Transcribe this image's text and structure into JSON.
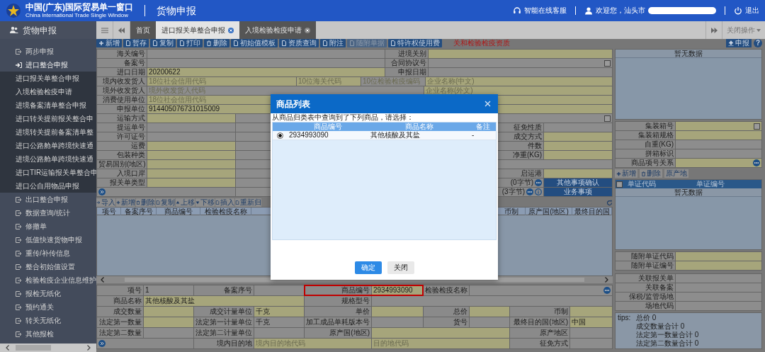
{
  "header": {
    "title": "中国(广东)国际贸易单一窗口",
    "subtitle": "China International Trade Single Window",
    "module": "货物申报",
    "service": "智能在线客服",
    "welcome": "欢迎您，汕头市",
    "logout": "退出"
  },
  "tab_bar": {
    "menu_title": "货物申报",
    "close_menu": "关闭操作",
    "tabs": [
      {
        "label": "首页",
        "selected": false,
        "closable": false
      },
      {
        "label": "进口报关单整合申报",
        "selected": true,
        "closable": true
      },
      {
        "label": "入境检验检疫申请",
        "selected": false,
        "closable": true
      }
    ]
  },
  "sidebar": {
    "items": [
      {
        "label": "两步申报",
        "expanded": false
      },
      {
        "label": "进口整合申报",
        "expanded": true,
        "children": [
          {
            "label": "进口报关单整合申报"
          },
          {
            "label": "入境检验检疫申请"
          },
          {
            "label": "进境备案清单整合申报"
          },
          {
            "label": "进口转关提前报关整合申"
          },
          {
            "label": "进境转关提前备案清单整"
          },
          {
            "label": "进口公路舱单跨境快速通"
          },
          {
            "label": "进境公路舱单跨境快速通"
          },
          {
            "label": "进口TIR运输报关单整合申"
          },
          {
            "label": "进口公自用物品申报"
          }
        ]
      },
      {
        "label": "出口整合申报",
        "expanded": false
      },
      {
        "label": "数据查询/统计",
        "expanded": false
      },
      {
        "label": "修撤单",
        "expanded": false
      },
      {
        "label": "低值快速货物申报",
        "expanded": false
      },
      {
        "label": "重传/补传信息",
        "expanded": false
      },
      {
        "label": "整合初始值设置",
        "expanded": false
      },
      {
        "label": "检验检疫企业信息维护",
        "expanded": false
      },
      {
        "label": "报检无纸化",
        "expanded": false
      },
      {
        "label": "预约通关",
        "expanded": false
      },
      {
        "label": "转关无纸化",
        "expanded": false
      },
      {
        "label": "其他报检",
        "expanded": false
      }
    ]
  },
  "toolbar": {
    "notice": "关和检验检疫资质",
    "buttons": [
      {
        "label": "新增",
        "disabled": false
      },
      {
        "label": "暂存",
        "disabled": false
      },
      {
        "label": "复制",
        "disabled": false
      },
      {
        "label": "打印",
        "disabled": false
      },
      {
        "label": "删除",
        "disabled": false
      },
      {
        "label": "初始值模板",
        "disabled": false
      },
      {
        "label": "资质查询",
        "disabled": false
      },
      {
        "label": "附注",
        "disabled": false
      },
      {
        "label": "随附单据",
        "disabled": true
      },
      {
        "label": "特许权使用费",
        "disabled": false
      }
    ]
  },
  "declaration_form": {
    "rows": [
      {
        "groups": [
          {
            "label": "海关编号",
            "inputs": [
              {
                "kind": "field",
                "required": false
              }
            ]
          },
          {
            "label": "进境关别",
            "inputs": [
              {
                "kind": "field",
                "required": true
              }
            ]
          }
        ]
      },
      {
        "groups": [
          {
            "label": "备案号",
            "inputs": [
              {
                "kind": "field",
                "required": false
              }
            ]
          },
          {
            "label": "合同协议号",
            "inputs": [
              {
                "kind": "field",
                "required": false,
                "checked": false
              }
            ]
          }
        ]
      },
      {
        "groups": [
          {
            "label": "进口日期",
            "inputs": [
              {
                "kind": "field",
                "required": true,
                "value": "20200622"
              }
            ]
          },
          {
            "label": "申报日期",
            "inputs": [
              {
                "kind": "field",
                "required": false
              }
            ]
          }
        ]
      },
      {
        "groups": [
          {
            "label": "境内收发货人",
            "inputs": [
              {
                "kind": "field",
                "required": true,
                "placeholder": "18位社会信用代码"
              },
              {
                "kind": "field",
                "required": true,
                "placeholder": "10位海关代码"
              },
              {
                "kind": "field",
                "required": false,
                "placeholder": "10位检验检疫编码"
              },
              {
                "kind": "field",
                "required": true,
                "placeholder": "企业名称(中文)"
              }
            ]
          }
        ]
      },
      {
        "groups": [
          {
            "label": "境外收发货人",
            "inputs": [
              {
                "kind": "field",
                "required": false,
                "placeholder": "境外收发货人代码"
              },
              {
                "kind": "field",
                "required": true,
                "placeholder": "企业名称(外文)"
              }
            ]
          }
        ]
      },
      {
        "groups": [
          {
            "label": "消费使用单位",
            "inputs": [
              {
                "kind": "field",
                "required": true,
                "placeholder": "18位社会信用代码"
              },
              {
                "kind": "field",
                "required": true
              }
            ]
          }
        ]
      },
      {
        "groups": [
          {
            "label": "申报单位",
            "inputs": [
              {
                "kind": "field",
                "required": true,
                "value": "914405076731015009"
              },
              {
                "kind": "field",
                "required": true
              }
            ]
          }
        ]
      },
      {
        "groups": [
          {
            "label": "运输方式",
            "inputs": [
              {
                "kind": "field",
                "required": true
              },
              {
                "kind": "field",
                "required": false,
                "checked": false
              }
            ]
          }
        ]
      },
      {
        "groups": [
          {
            "label": "提运单号",
            "inputs": [
              {
                "kind": "field",
                "required": false
              },
              {
                "kind": "field",
                "required": false
              }
            ]
          },
          {
            "label": "征免性质",
            "inputs": [
              {
                "kind": "field",
                "required": false
              }
            ]
          }
        ]
      },
      {
        "groups": [
          {
            "label": "许可证号",
            "inputs": [
              {
                "kind": "field",
                "required": false
              },
              {
                "kind": "field",
                "required": false
              }
            ]
          },
          {
            "label": "成交方式",
            "inputs": [
              {
                "kind": "field",
                "required": true
              }
            ]
          }
        ]
      },
      {
        "groups": [
          {
            "label": "运费",
            "inputs": [
              {
                "kind": "field",
                "required": true
              },
              {
                "kind": "field",
                "required": false
              }
            ]
          },
          {
            "label": "件数",
            "inputs": [
              {
                "kind": "field",
                "required": true
              }
            ]
          }
        ]
      },
      {
        "groups": [
          {
            "label": "包装种类",
            "inputs": [
              {
                "kind": "field",
                "required": true
              },
              {
                "kind": "field",
                "required": false
              }
            ]
          },
          {
            "label": "净重(KG)",
            "inputs": [
              {
                "kind": "field",
                "required": true
              }
            ]
          }
        ]
      },
      {
        "groups": [
          {
            "label": "贸易国别(地区)",
            "inputs": [
              {
                "kind": "field",
                "required": true
              },
              {
                "kind": "field",
                "required": false
              }
            ]
          }
        ]
      },
      {
        "groups": [
          {
            "label": "入境口岸",
            "inputs": [
              {
                "kind": "field",
                "required": true
              },
              {
                "kind": "field",
                "required": false
              }
            ]
          },
          {
            "label": "启运港",
            "inputs": [
              {
                "kind": "field",
                "required": true
              }
            ]
          }
        ]
      },
      {
        "groups": [
          {
            "label": "报关单类型",
            "inputs": [
              {
                "kind": "field",
                "required": true
              },
              {
                "kind": "field",
                "required": false
              }
            ]
          },
          {
            "counter": {
              "text": "(0字节)",
              "info": false
            },
            "inputs": [
              {
                "kind": "button",
                "text": "其他事项确认"
              }
            ]
          }
        ]
      },
      {
        "groups": [
          {
            "expand": true,
            "inputs": [
              {
                "kind": "field",
                "required": false
              }
            ]
          },
          {
            "counter": {
              "text": "(3字节)",
              "info": true
            },
            "inputs": [
              {
                "kind": "button",
                "text": "业务事项"
              }
            ]
          }
        ]
      }
    ]
  },
  "goods": {
    "toolbar": [
      "导入",
      "新增",
      "删除",
      "复制",
      "上移",
      "下移",
      "插入",
      "重新归"
    ],
    "columns_left": [
      "项号",
      "备案序号",
      "商品编号",
      "检验检疫名称"
    ],
    "columns_right": [
      "币制",
      "原产国(地区)",
      "最终目的国"
    ]
  },
  "item_form": {
    "rows": [
      {
        "groups": [
          {
            "label": "项号",
            "inputs": [
              {
                "kind": "field",
                "required": false,
                "value": "1"
              }
            ]
          },
          {
            "label": "备案序号",
            "inputs": [
              {
                "kind": "field",
                "required": false
              }
            ]
          },
          {
            "label": "商品编号",
            "highlighted": true,
            "inputs": [
              {
                "kind": "field",
                "required": true,
                "value": "2934993090"
              }
            ]
          },
          {
            "label": "检验检疫名称",
            "inputs": [
              {
                "kind": "lookup",
                "required": false
              }
            ]
          }
        ]
      },
      {
        "groups": [
          {
            "label": "商品名称",
            "inputs": [
              {
                "kind": "field",
                "required": true,
                "value": "其他核酸及其盐"
              }
            ]
          },
          {
            "label": "规格型号",
            "inputs": [
              {
                "kind": "field",
                "required": false
              }
            ]
          }
        ]
      },
      {
        "groups": [
          {
            "label": "成交数量",
            "inputs": [
              {
                "kind": "field",
                "required": true
              }
            ]
          },
          {
            "label": "成交计量单位",
            "inputs": [
              {
                "kind": "field",
                "required": true,
                "value": "千克"
              }
            ]
          },
          {
            "label": "单价",
            "inputs": [
              {
                "kind": "field",
                "required": true
              }
            ]
          },
          {
            "label": "总价",
            "inputs": [
              {
                "kind": "field",
                "required": true
              }
            ]
          },
          {
            "label": "币制",
            "inputs": [
              {
                "kind": "field",
                "required": true
              }
            ]
          }
        ]
      },
      {
        "groups": [
          {
            "label": "法定第一数量",
            "inputs": [
              {
                "kind": "field",
                "required": true
              }
            ]
          },
          {
            "label": "法定第一计量单位",
            "inputs": [
              {
                "kind": "field",
                "required": false,
                "value": "千克"
              }
            ]
          },
          {
            "label": "加工成品单耗版本号",
            "inputs": [
              {
                "kind": "field",
                "required": false
              }
            ]
          },
          {
            "label": "货号",
            "inputs": [
              {
                "kind": "field",
                "required": false
              }
            ]
          },
          {
            "label": "最终目的国(地区)",
            "inputs": [
              {
                "kind": "field",
                "required": true,
                "value": "中国"
              }
            ]
          }
        ]
      },
      {
        "groups": [
          {
            "label": "法定第二数量",
            "inputs": [
              {
                "kind": "field",
                "required": false
              }
            ]
          },
          {
            "label": "法定第二计量单位",
            "inputs": [
              {
                "kind": "field",
                "required": false
              }
            ]
          },
          {
            "label": "原产国(地区)",
            "inputs": [
              {
                "kind": "field",
                "required": true
              }
            ]
          },
          {
            "label": "原产地区",
            "inputs": [
              {
                "kind": "field",
                "required": false
              }
            ]
          }
        ]
      },
      {
        "groups": [
          {
            "expand": true
          },
          {
            "label": "境内目的地",
            "inputs": [
              {
                "kind": "field",
                "required": true,
                "placeholder": "境内目的地代码"
              },
              {
                "kind": "field",
                "required": true,
                "placeholder": "目的地代码"
              }
            ]
          },
          {
            "label": "征免方式",
            "inputs": [
              {
                "kind": "field",
                "required": false
              }
            ]
          }
        ]
      }
    ]
  },
  "side_panel": {
    "declare_button": "申报",
    "help": "?",
    "upper_empty_text": "暂无数据",
    "container_fields": [
      {
        "kind": "field",
        "label": "集装箱号",
        "required": true,
        "checked": false
      },
      {
        "kind": "field",
        "label": "集装箱规格",
        "required": true
      },
      {
        "kind": "field",
        "label": "自重(KG)",
        "required": false
      },
      {
        "kind": "field",
        "label": "拼箱标识",
        "required": false
      },
      {
        "kind": "lookup",
        "label": "商品项号关系",
        "required": true
      }
    ],
    "doc_toolbar": [
      "新增",
      "删除",
      "原产地"
    ],
    "doc_table": {
      "checked": false,
      "columns": [
        "单证代码",
        "单证编号"
      ],
      "empty_text": "暂无数据"
    },
    "doc_fields": [
      {
        "kind": "field",
        "label": "随附单证代码",
        "required": true
      },
      {
        "kind": "field",
        "label": "随附单证编号",
        "required": true
      }
    ],
    "link_fields": [
      {
        "kind": "field",
        "label": "关联报关单",
        "required": false
      },
      {
        "kind": "field",
        "label": "关联备案",
        "required": false
      },
      {
        "kind": "field",
        "label": "保税/监管场地",
        "required": false
      },
      {
        "kind": "field",
        "label": "场地代码",
        "required": false
      }
    ],
    "tips": {
      "prefix": "tips:",
      "lines": [
        "总价 0",
        "成交数量合计 0",
        "法定第一数量合计 0",
        "法定第二数量合计 0"
      ]
    }
  },
  "dialog": {
    "title": "商品列表",
    "message": "从商品归类表中查询到了下列商品，请选择：",
    "columns": [
      "商品编号",
      "商品名称",
      "备注"
    ],
    "rows": [
      {
        "selected": true,
        "cells": [
          "2934993090",
          "其他核酸及其盐",
          "-"
        ]
      }
    ],
    "buttons": [
      {
        "label": "确定",
        "kind": "primary"
      },
      {
        "label": "关闭",
        "kind": "secondary"
      }
    ]
  }
}
